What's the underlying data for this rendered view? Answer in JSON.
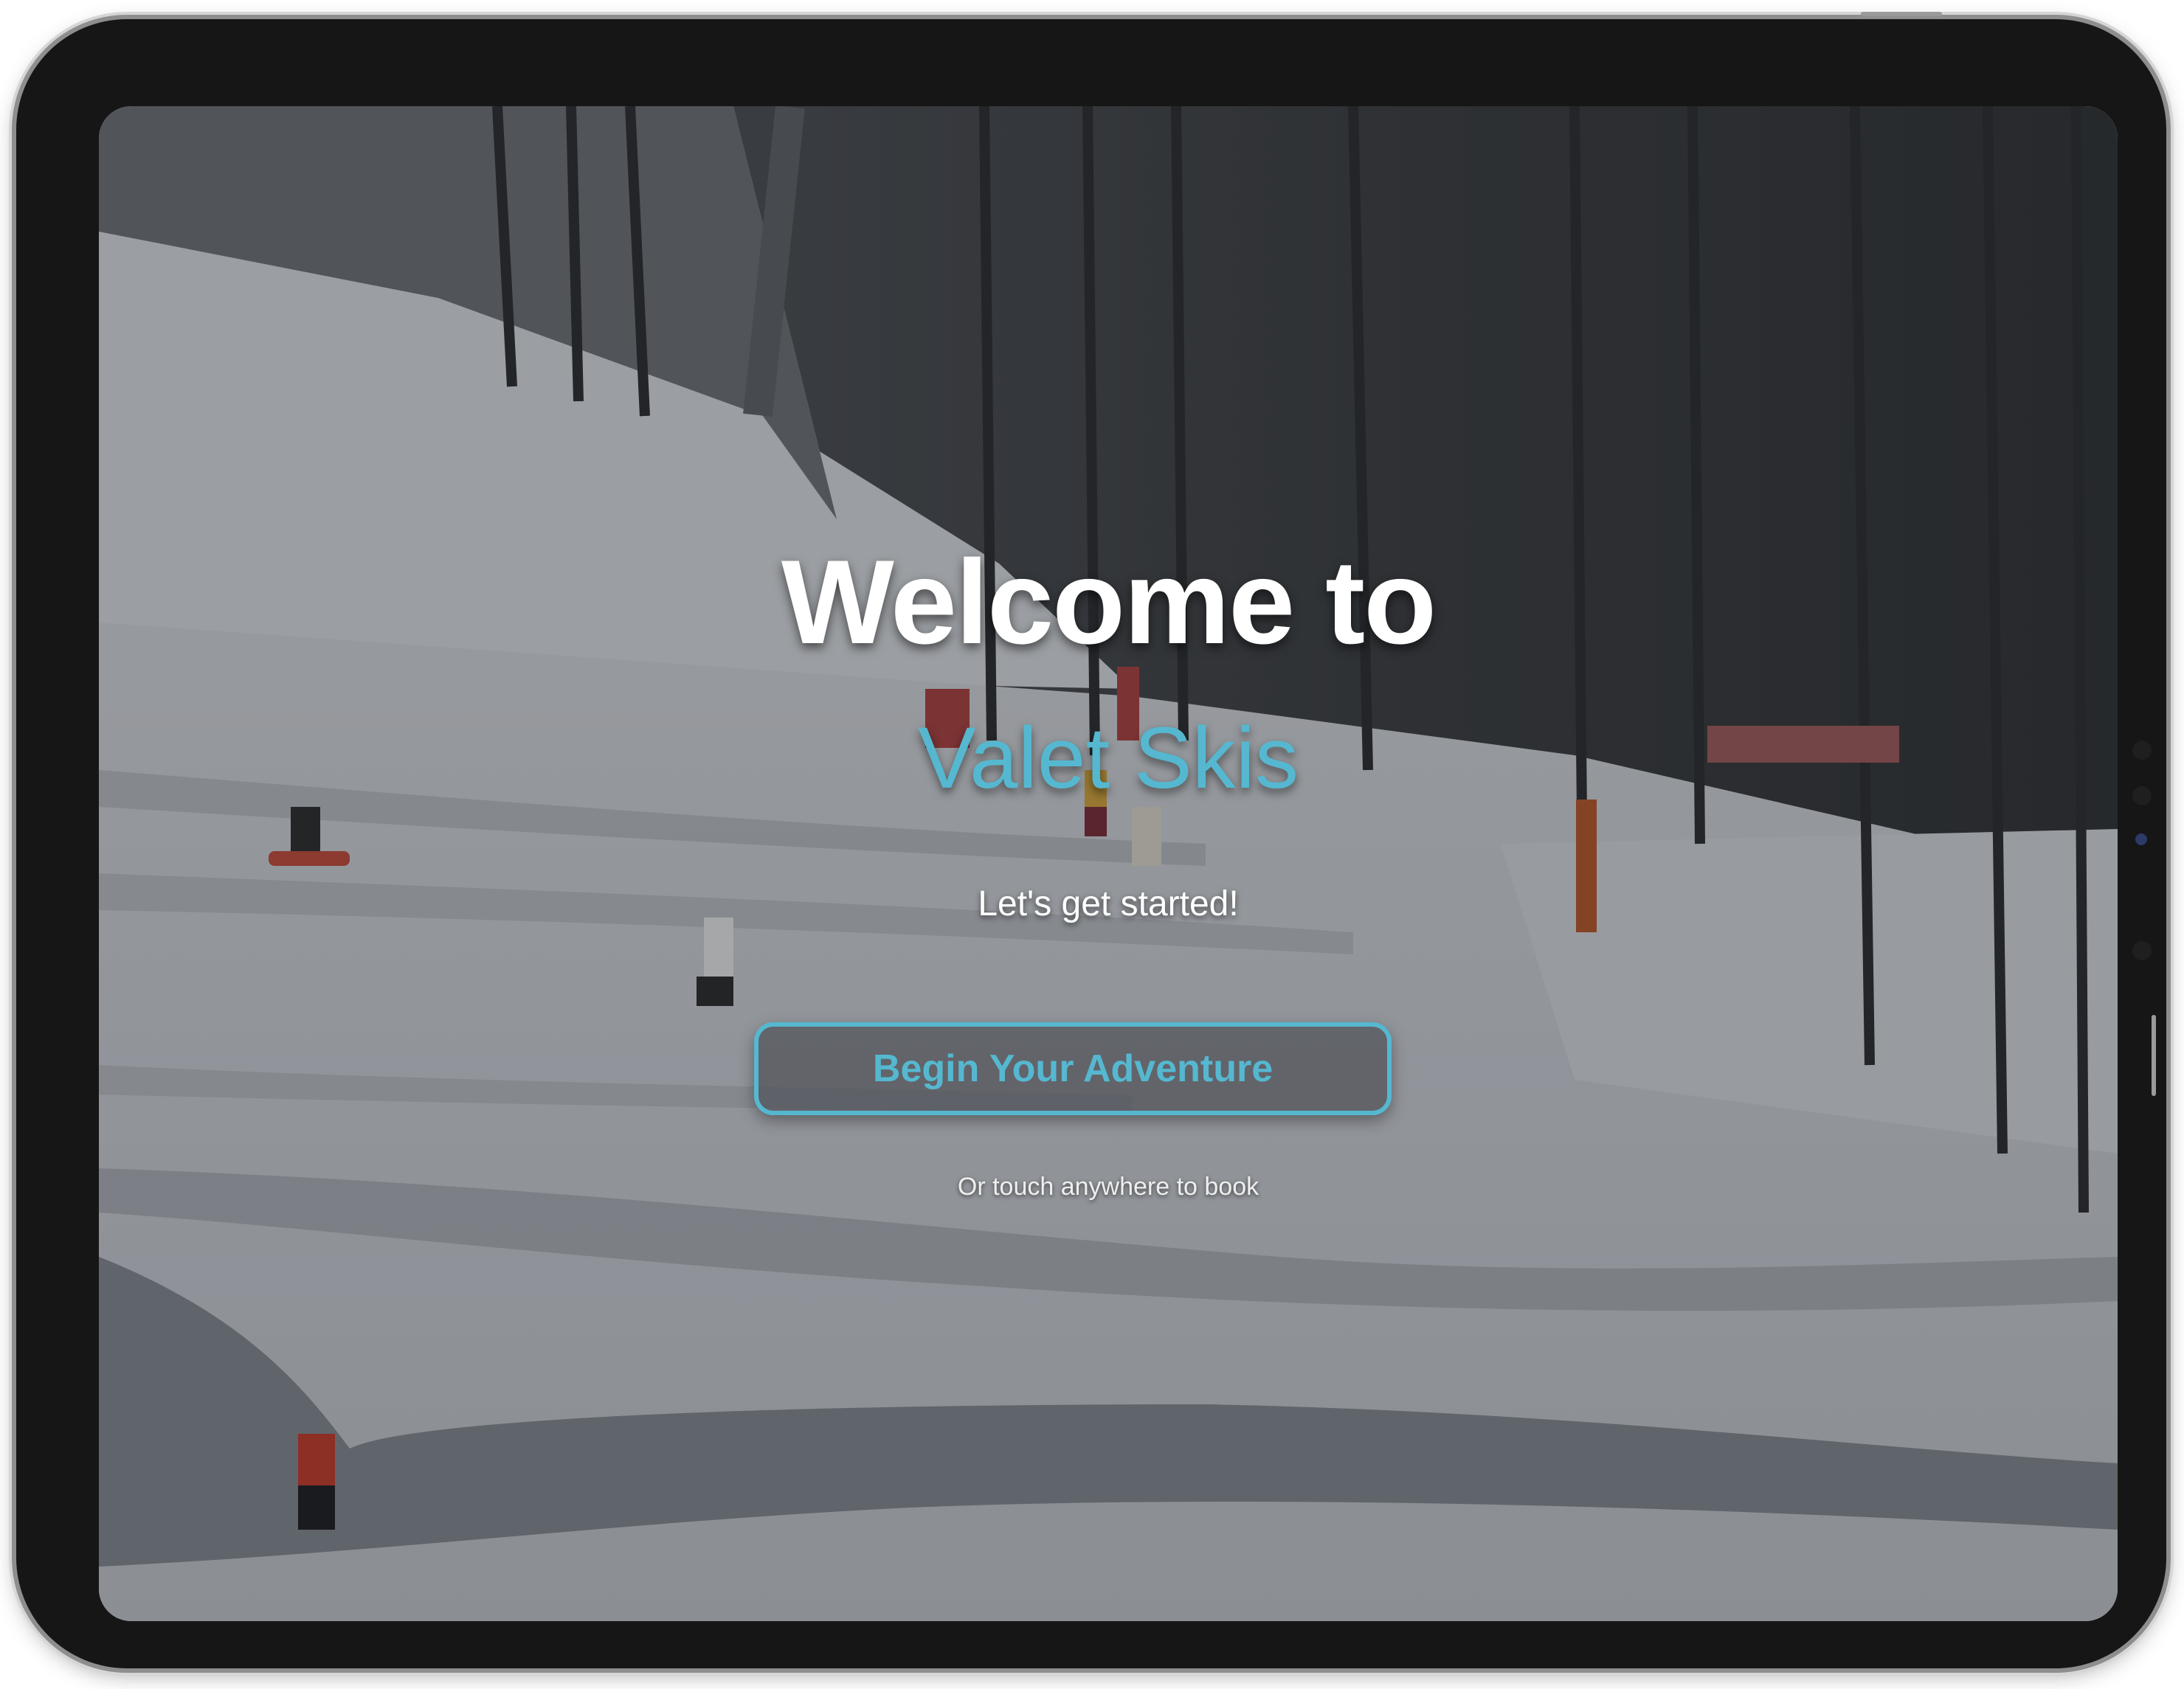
{
  "welcome": {
    "headline": "Welcome to",
    "brand_name": "Valet Skis",
    "tagline": "Let's get started!",
    "cta_label": "Begin Your Adventure",
    "hint": "Or touch anywhere to book"
  },
  "background": {
    "scene": "ski-slope-photo"
  },
  "colors": {
    "accent": "#55b8d0",
    "text": "#ffffff",
    "device_frame": "#161616"
  }
}
